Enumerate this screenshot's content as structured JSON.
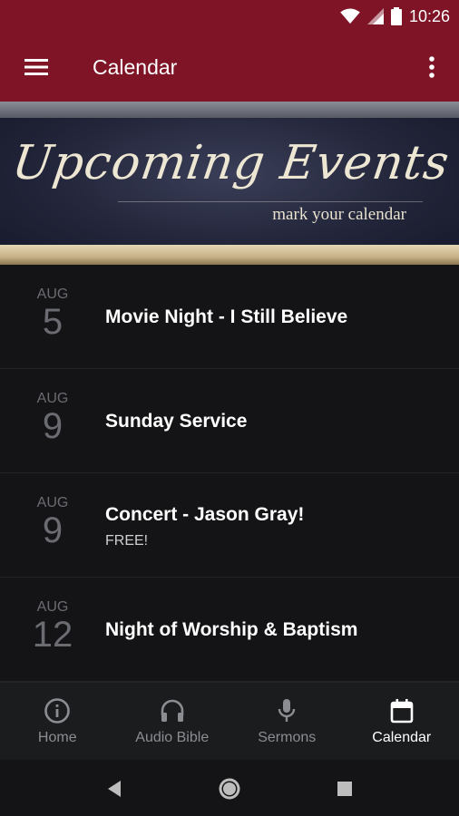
{
  "status_bar": {
    "time": "10:26"
  },
  "app_bar": {
    "title": "Calendar"
  },
  "banner": {
    "title": "Upcoming Events",
    "subtitle": "mark your calendar"
  },
  "events": [
    {
      "month": "AUG",
      "day": "5",
      "title": "Movie Night - I Still Believe",
      "subtitle": ""
    },
    {
      "month": "AUG",
      "day": "9",
      "title": "Sunday Service",
      "subtitle": ""
    },
    {
      "month": "AUG",
      "day": "9",
      "title": "Concert - Jason Gray!",
      "subtitle": "FREE!"
    },
    {
      "month": "AUG",
      "day": "12",
      "title": "Night of Worship & Baptism",
      "subtitle": ""
    }
  ],
  "bottom_nav": {
    "items": [
      {
        "label": "Home",
        "icon": "info-circle-icon",
        "active": false
      },
      {
        "label": "Audio Bible",
        "icon": "headphones-icon",
        "active": false
      },
      {
        "label": "Sermons",
        "icon": "microphone-icon",
        "active": false
      },
      {
        "label": "Calendar",
        "icon": "calendar-icon",
        "active": true
      }
    ]
  },
  "colors": {
    "app_bar": "#7e1426",
    "background": "#141416",
    "nav_background": "#1b1c1e",
    "muted_text": "#6a6c72",
    "inactive_nav": "#8b8d92"
  }
}
